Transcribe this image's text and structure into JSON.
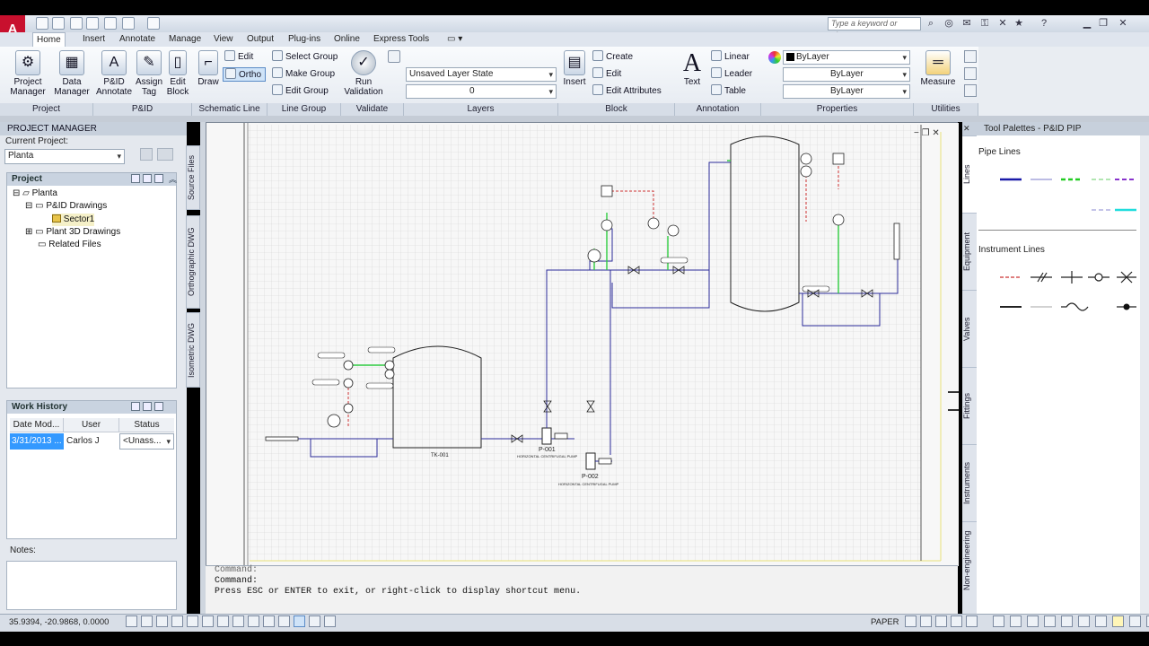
{
  "app": {
    "search_placeholder": "Type a keyword or phrase",
    "tabs": [
      "Home",
      "Insert",
      "Annotate",
      "Manage",
      "View",
      "Output",
      "Plug-ins",
      "Online",
      "Express Tools"
    ]
  },
  "ribbon": {
    "project_manager": "Project\nManager",
    "data_manager": "Data\nManager",
    "pid_annotate": "P&ID\nAnnotate",
    "assign_tag": "Assign\nTag",
    "edit_block": "Edit\nBlock",
    "draw": "Draw",
    "edit": "Edit",
    "ortho": "Ortho",
    "select_group": "Select Group",
    "make_group": "Make Group",
    "edit_group": "Edit Group",
    "run_validation": "Run\nValidation",
    "layer_state": "Unsaved Layer State",
    "layer_value": "0",
    "insert": "Insert",
    "create": "Create",
    "block_edit": "Edit",
    "edit_attributes": "Edit Attributes",
    "text": "Text",
    "linear": "Linear",
    "leader": "Leader",
    "table": "Table",
    "color": "ByLayer",
    "linetype": "ByLayer",
    "lineweight": "ByLayer",
    "measure": "Measure",
    "panels": {
      "project": "Project",
      "pid": "P&ID",
      "schematic_line": "Schematic Line",
      "line_group": "Line Group",
      "validate": "Validate",
      "layers": "Layers",
      "block": "Block",
      "annotation": "Annotation",
      "properties": "Properties",
      "utilities": "Utilities"
    }
  },
  "project_manager": {
    "title": "PROJECT MANAGER",
    "current_project_label": "Current Project:",
    "current_project": "Planta",
    "project_header": "Project",
    "tree": {
      "root": "Planta",
      "pid_drawings": "P&ID Drawings",
      "sector": "Sector1",
      "plant3d": "Plant 3D Drawings",
      "related": "Related Files"
    },
    "side_tabs": [
      "Source Files",
      "Orthographic DWG",
      "Isometric DWG"
    ],
    "work_history_header": "Work History",
    "columns": [
      "Date Mod...",
      "User",
      "Status"
    ],
    "row": {
      "date": "3/31/2013 ...",
      "user": "Carlos J",
      "status": "<Unass..."
    },
    "notes_label": "Notes:"
  },
  "drawing": {
    "equip": {
      "tank1": "TK-001",
      "pump1": "P-001",
      "pump1_desc": "HORIZONTAL CENTRIFUGAL PUMP",
      "pump2": "P-002",
      "pump2_desc": "HORIZONTAL CENTRIFUGAL PUMP"
    }
  },
  "command": {
    "line1": "Command:",
    "line2": "Command:",
    "line3": "Press ESC or ENTER to exit, or right-click to display shortcut menu."
  },
  "status": {
    "coords": "35.9394, -20.9868, 0.0000",
    "paper": "PAPER"
  },
  "tool_palette": {
    "title": "Tool Palettes - P&ID PIP",
    "tabs": [
      "Lines",
      "Equipment",
      "Valves",
      "Fittings",
      "Instruments",
      "Non-engineering"
    ],
    "pipe_lines": "Pipe Lines",
    "instrument_lines": "Instrument Lines"
  },
  "colors": {
    "accent": "#c8102e",
    "grid": "#dcdcdc",
    "green_line": "#22cc33",
    "red_line": "#cc3333",
    "blue_line": "#2222aa"
  }
}
